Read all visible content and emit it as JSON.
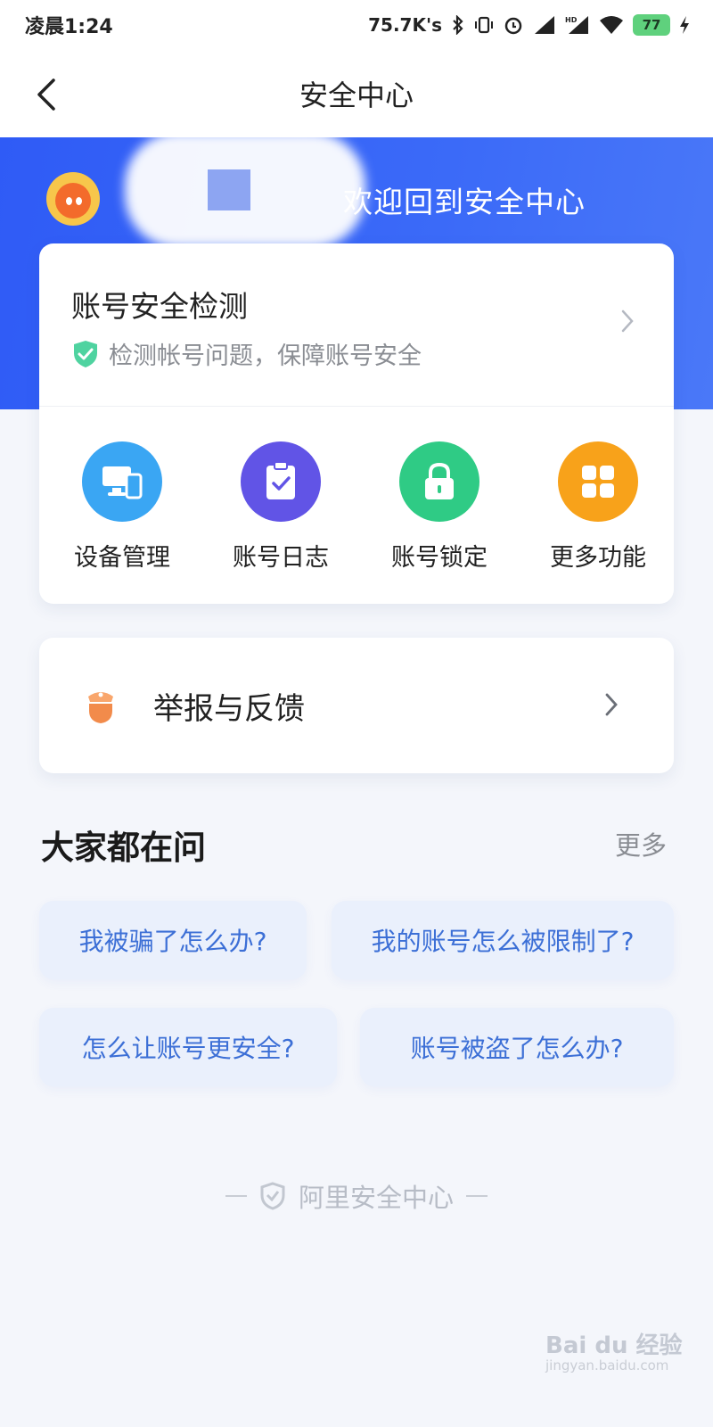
{
  "status_bar": {
    "time": "凌晨1:24",
    "speed": "75.7K's",
    "battery": "77"
  },
  "nav": {
    "title": "安全中心"
  },
  "hero": {
    "welcome": "欢迎回到安全中心"
  },
  "detect": {
    "title": "账号安全检测",
    "subtitle": "检测帐号问题，保障账号安全"
  },
  "functions": [
    {
      "label": "设备管理",
      "icon": "device-icon",
      "color": "#3aa6f3"
    },
    {
      "label": "账号日志",
      "icon": "log-icon",
      "color": "#6154e6"
    },
    {
      "label": "账号锁定",
      "icon": "lock-icon",
      "color": "#2fcb85"
    },
    {
      "label": "更多功能",
      "icon": "grid-icon",
      "color": "#f8a21a"
    }
  ],
  "report": {
    "label": "举报与反馈"
  },
  "faq_section": {
    "title": "大家都在问",
    "more": "更多",
    "questions": [
      "我被骗了怎么办?",
      "我的账号怎么被限制了?",
      "怎么让账号更安全?",
      "账号被盗了怎么办?"
    ]
  },
  "footer": {
    "text": "阿里安全中心"
  },
  "watermark": {
    "brand": "Bai du 经验",
    "url": "jingyan.baidu.com"
  }
}
